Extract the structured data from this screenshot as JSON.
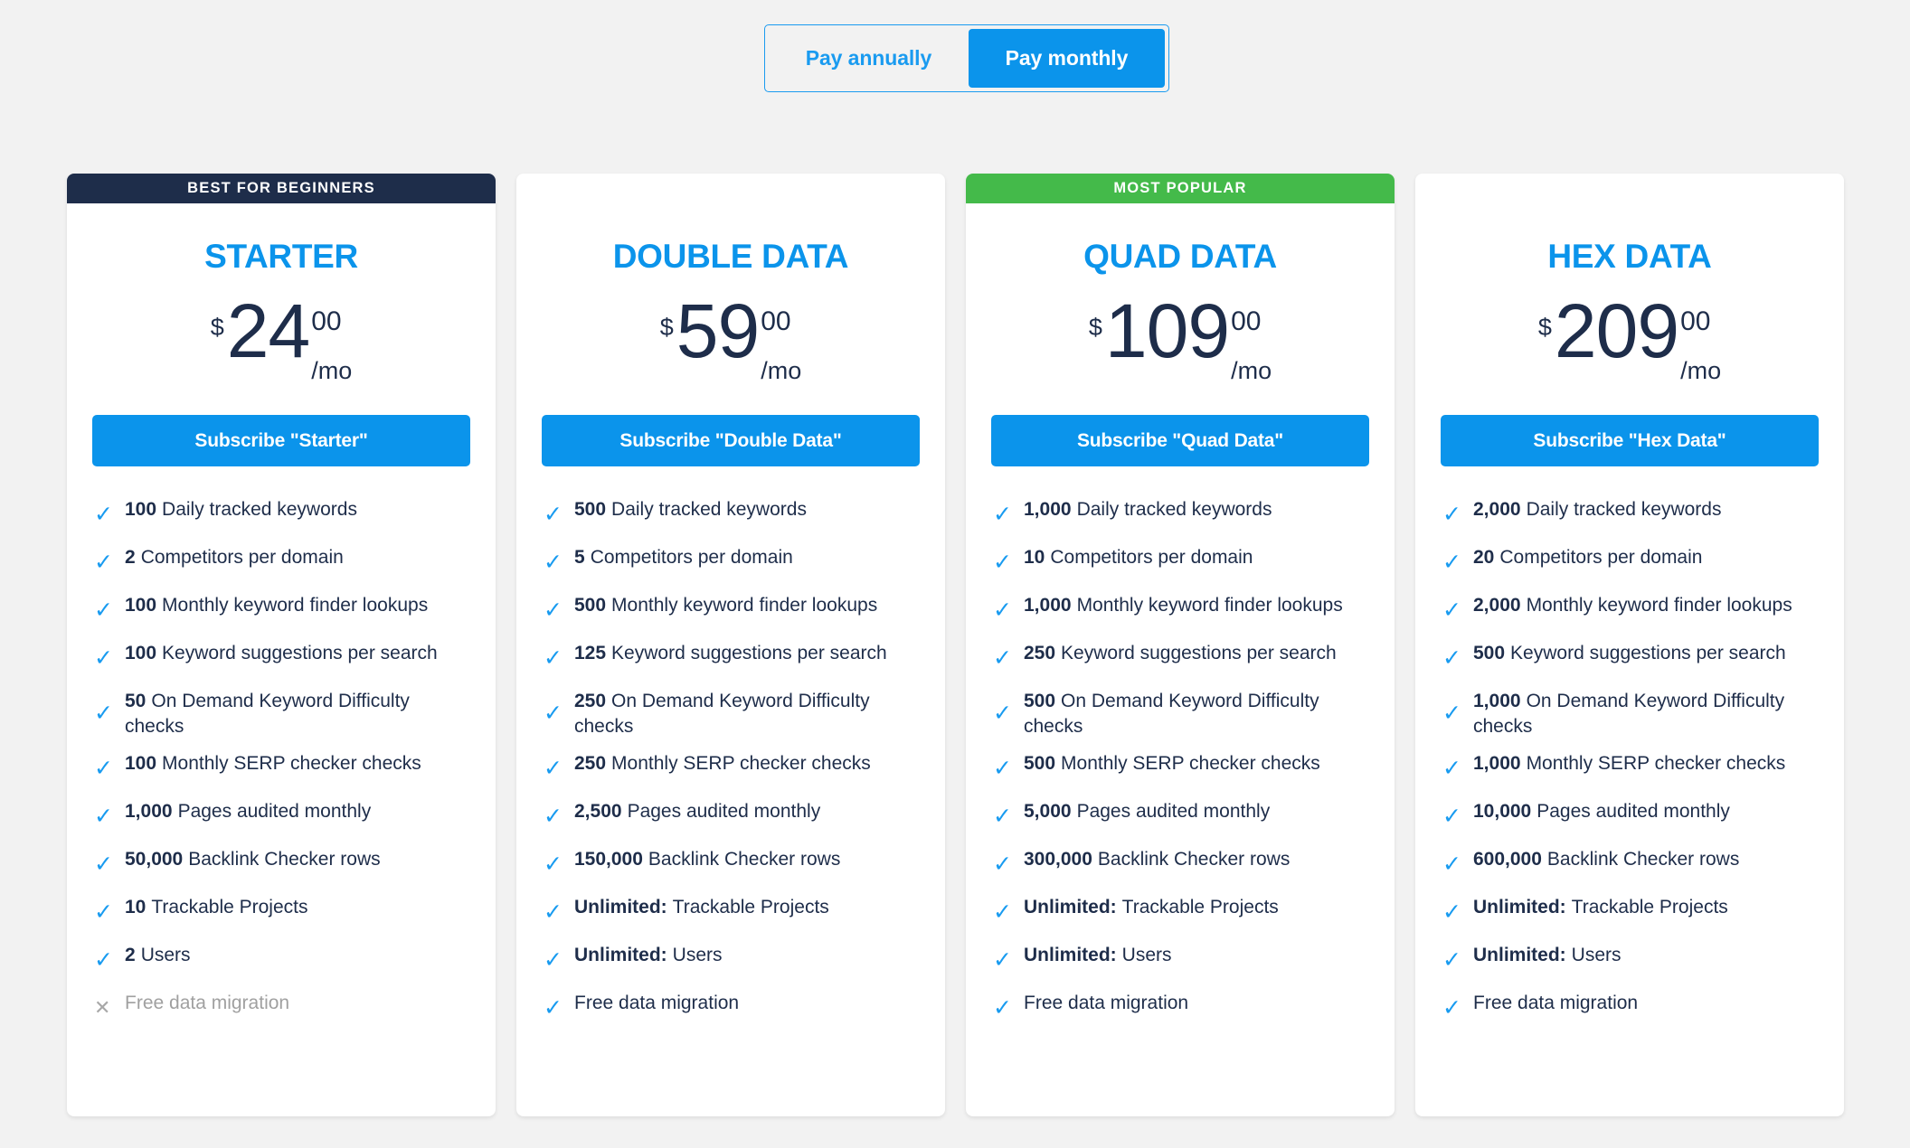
{
  "billing_toggle": {
    "annual_label": "Pay annually",
    "monthly_label": "Pay monthly",
    "selected": "monthly"
  },
  "colors": {
    "accent_blue": "#0b94eb",
    "navy": "#1e2d4a",
    "green": "#44ba4a",
    "muted": "#a0a0a0",
    "page_bg": "#f2f2f2"
  },
  "plans": [
    {
      "ribbon": "BEST FOR BEGINNERS",
      "ribbon_style": "navy",
      "name": "STARTER",
      "currency": "$",
      "amount": "24",
      "cents": "00",
      "period": "/mo",
      "cta": "Subscribe \"Starter\"",
      "features": [
        {
          "qty": "100",
          "label": "Daily tracked keywords",
          "included": true
        },
        {
          "qty": "2",
          "label": "Competitors per domain",
          "included": true
        },
        {
          "qty": "100",
          "label": "Monthly keyword finder lookups",
          "included": true
        },
        {
          "qty": "100",
          "label": "Keyword suggestions per search",
          "included": true
        },
        {
          "qty": "50",
          "label": "On Demand Keyword Difficulty checks",
          "included": true
        },
        {
          "qty": "100",
          "label": "Monthly SERP checker checks",
          "included": true
        },
        {
          "qty": "1,000",
          "label": "Pages audited monthly",
          "included": true
        },
        {
          "qty": "50,000",
          "label": "Backlink Checker rows",
          "included": true
        },
        {
          "qty": "10",
          "label": "Trackable Projects",
          "included": true
        },
        {
          "qty": "2",
          "label": "Users",
          "included": true
        },
        {
          "qty": "",
          "label": "Free data migration",
          "included": false
        }
      ]
    },
    {
      "ribbon": "",
      "ribbon_style": "blank",
      "name": "DOUBLE DATA",
      "currency": "$",
      "amount": "59",
      "cents": "00",
      "period": "/mo",
      "cta": "Subscribe \"Double Data\"",
      "features": [
        {
          "qty": "500",
          "label": "Daily tracked keywords",
          "included": true
        },
        {
          "qty": "5",
          "label": "Competitors per domain",
          "included": true
        },
        {
          "qty": "500",
          "label": "Monthly keyword finder lookups",
          "included": true
        },
        {
          "qty": "125",
          "label": "Keyword suggestions per search",
          "included": true
        },
        {
          "qty": "250",
          "label": "On Demand Keyword Difficulty checks",
          "included": true
        },
        {
          "qty": "250",
          "label": "Monthly SERP checker checks",
          "included": true
        },
        {
          "qty": "2,500",
          "label": "Pages audited monthly",
          "included": true
        },
        {
          "qty": "150,000",
          "label": "Backlink Checker rows",
          "included": true
        },
        {
          "qty": "Unlimited:",
          "label": "Trackable Projects",
          "included": true
        },
        {
          "qty": "Unlimited:",
          "label": "Users",
          "included": true
        },
        {
          "qty": "",
          "label": "Free data migration",
          "included": true
        }
      ]
    },
    {
      "ribbon": "MOST POPULAR",
      "ribbon_style": "green",
      "name": "QUAD DATA",
      "currency": "$",
      "amount": "109",
      "cents": "00",
      "period": "/mo",
      "cta": "Subscribe \"Quad Data\"",
      "features": [
        {
          "qty": "1,000",
          "label": "Daily tracked keywords",
          "included": true
        },
        {
          "qty": "10",
          "label": "Competitors per domain",
          "included": true
        },
        {
          "qty": "1,000",
          "label": "Monthly keyword finder lookups",
          "included": true
        },
        {
          "qty": "250",
          "label": "Keyword suggestions per search",
          "included": true
        },
        {
          "qty": "500",
          "label": "On Demand Keyword Difficulty checks",
          "included": true
        },
        {
          "qty": "500",
          "label": "Monthly SERP checker checks",
          "included": true
        },
        {
          "qty": "5,000",
          "label": "Pages audited monthly",
          "included": true
        },
        {
          "qty": "300,000",
          "label": "Backlink Checker rows",
          "included": true
        },
        {
          "qty": "Unlimited:",
          "label": "Trackable Projects",
          "included": true
        },
        {
          "qty": "Unlimited:",
          "label": "Users",
          "included": true
        },
        {
          "qty": "",
          "label": "Free data migration",
          "included": true
        }
      ]
    },
    {
      "ribbon": "",
      "ribbon_style": "blank",
      "name": "HEX DATA",
      "currency": "$",
      "amount": "209",
      "cents": "00",
      "period": "/mo",
      "cta": "Subscribe \"Hex Data\"",
      "features": [
        {
          "qty": "2,000",
          "label": "Daily tracked keywords",
          "included": true
        },
        {
          "qty": "20",
          "label": "Competitors per domain",
          "included": true
        },
        {
          "qty": "2,000",
          "label": "Monthly keyword finder lookups",
          "included": true
        },
        {
          "qty": "500",
          "label": "Keyword suggestions per search",
          "included": true
        },
        {
          "qty": "1,000",
          "label": "On Demand Keyword Difficulty checks",
          "included": true
        },
        {
          "qty": "1,000",
          "label": "Monthly SERP checker checks",
          "included": true
        },
        {
          "qty": "10,000",
          "label": "Pages audited monthly",
          "included": true
        },
        {
          "qty": "600,000",
          "label": "Backlink Checker rows",
          "included": true
        },
        {
          "qty": "Unlimited:",
          "label": "Trackable Projects",
          "included": true
        },
        {
          "qty": "Unlimited:",
          "label": "Users",
          "included": true
        },
        {
          "qty": "",
          "label": "Free data migration",
          "included": true
        }
      ]
    }
  ],
  "icons": {
    "check": "✓",
    "cross": "✕"
  }
}
